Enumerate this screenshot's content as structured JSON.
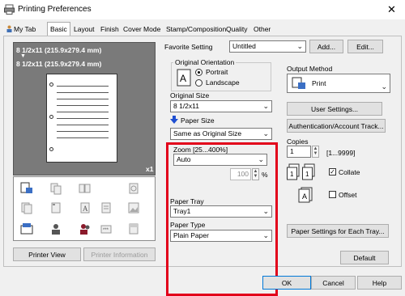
{
  "window": {
    "title": "Printing Preferences",
    "close_label": "✕"
  },
  "tabs": [
    {
      "label": "My Tab"
    },
    {
      "label": "Basic"
    },
    {
      "label": "Layout"
    },
    {
      "label": "Finish"
    },
    {
      "label": "Cover Mode"
    },
    {
      "label": "Stamp/Composition"
    },
    {
      "label": "Quality"
    },
    {
      "label": "Other"
    }
  ],
  "preview": {
    "line1": "8 1/2x11 (215.9x279.4 mm)",
    "arrow": "▼",
    "line2": "8 1/2x11 (215.9x279.4 mm)",
    "zoom_label": "x1",
    "printer_view_label": "Printer View",
    "printer_info_label": "Printer Information"
  },
  "favorite": {
    "label": "Favorite Setting",
    "value": "Untitled",
    "add_label": "Add...",
    "edit_label": "Edit..."
  },
  "orientation": {
    "label": "Original Orientation",
    "portrait": "Portrait",
    "landscape": "Landscape"
  },
  "original_size": {
    "label": "Original Size",
    "value": "8 1/2x11"
  },
  "paper_size": {
    "label": "Paper Size",
    "value": "Same as Original Size"
  },
  "zoom": {
    "label": "Zoom [25...400%]",
    "mode": "Auto",
    "value": "100",
    "unit": "%"
  },
  "paper_tray": {
    "label": "Paper Tray",
    "value": "Tray1"
  },
  "paper_type": {
    "label": "Paper Type",
    "value": "Plain Paper"
  },
  "output": {
    "label": "Output Method",
    "value": "Print",
    "user_settings": "User Settings...",
    "auth_track": "Authentication/Account Track..."
  },
  "copies": {
    "label": "Copies",
    "value": "1",
    "range": "[1...9999]",
    "collate": "Collate",
    "offset": "Offset"
  },
  "paper_settings_tray": "Paper Settings for Each Tray...",
  "default_label": "Default",
  "buttons": {
    "ok": "OK",
    "cancel": "Cancel",
    "help": "Help"
  }
}
